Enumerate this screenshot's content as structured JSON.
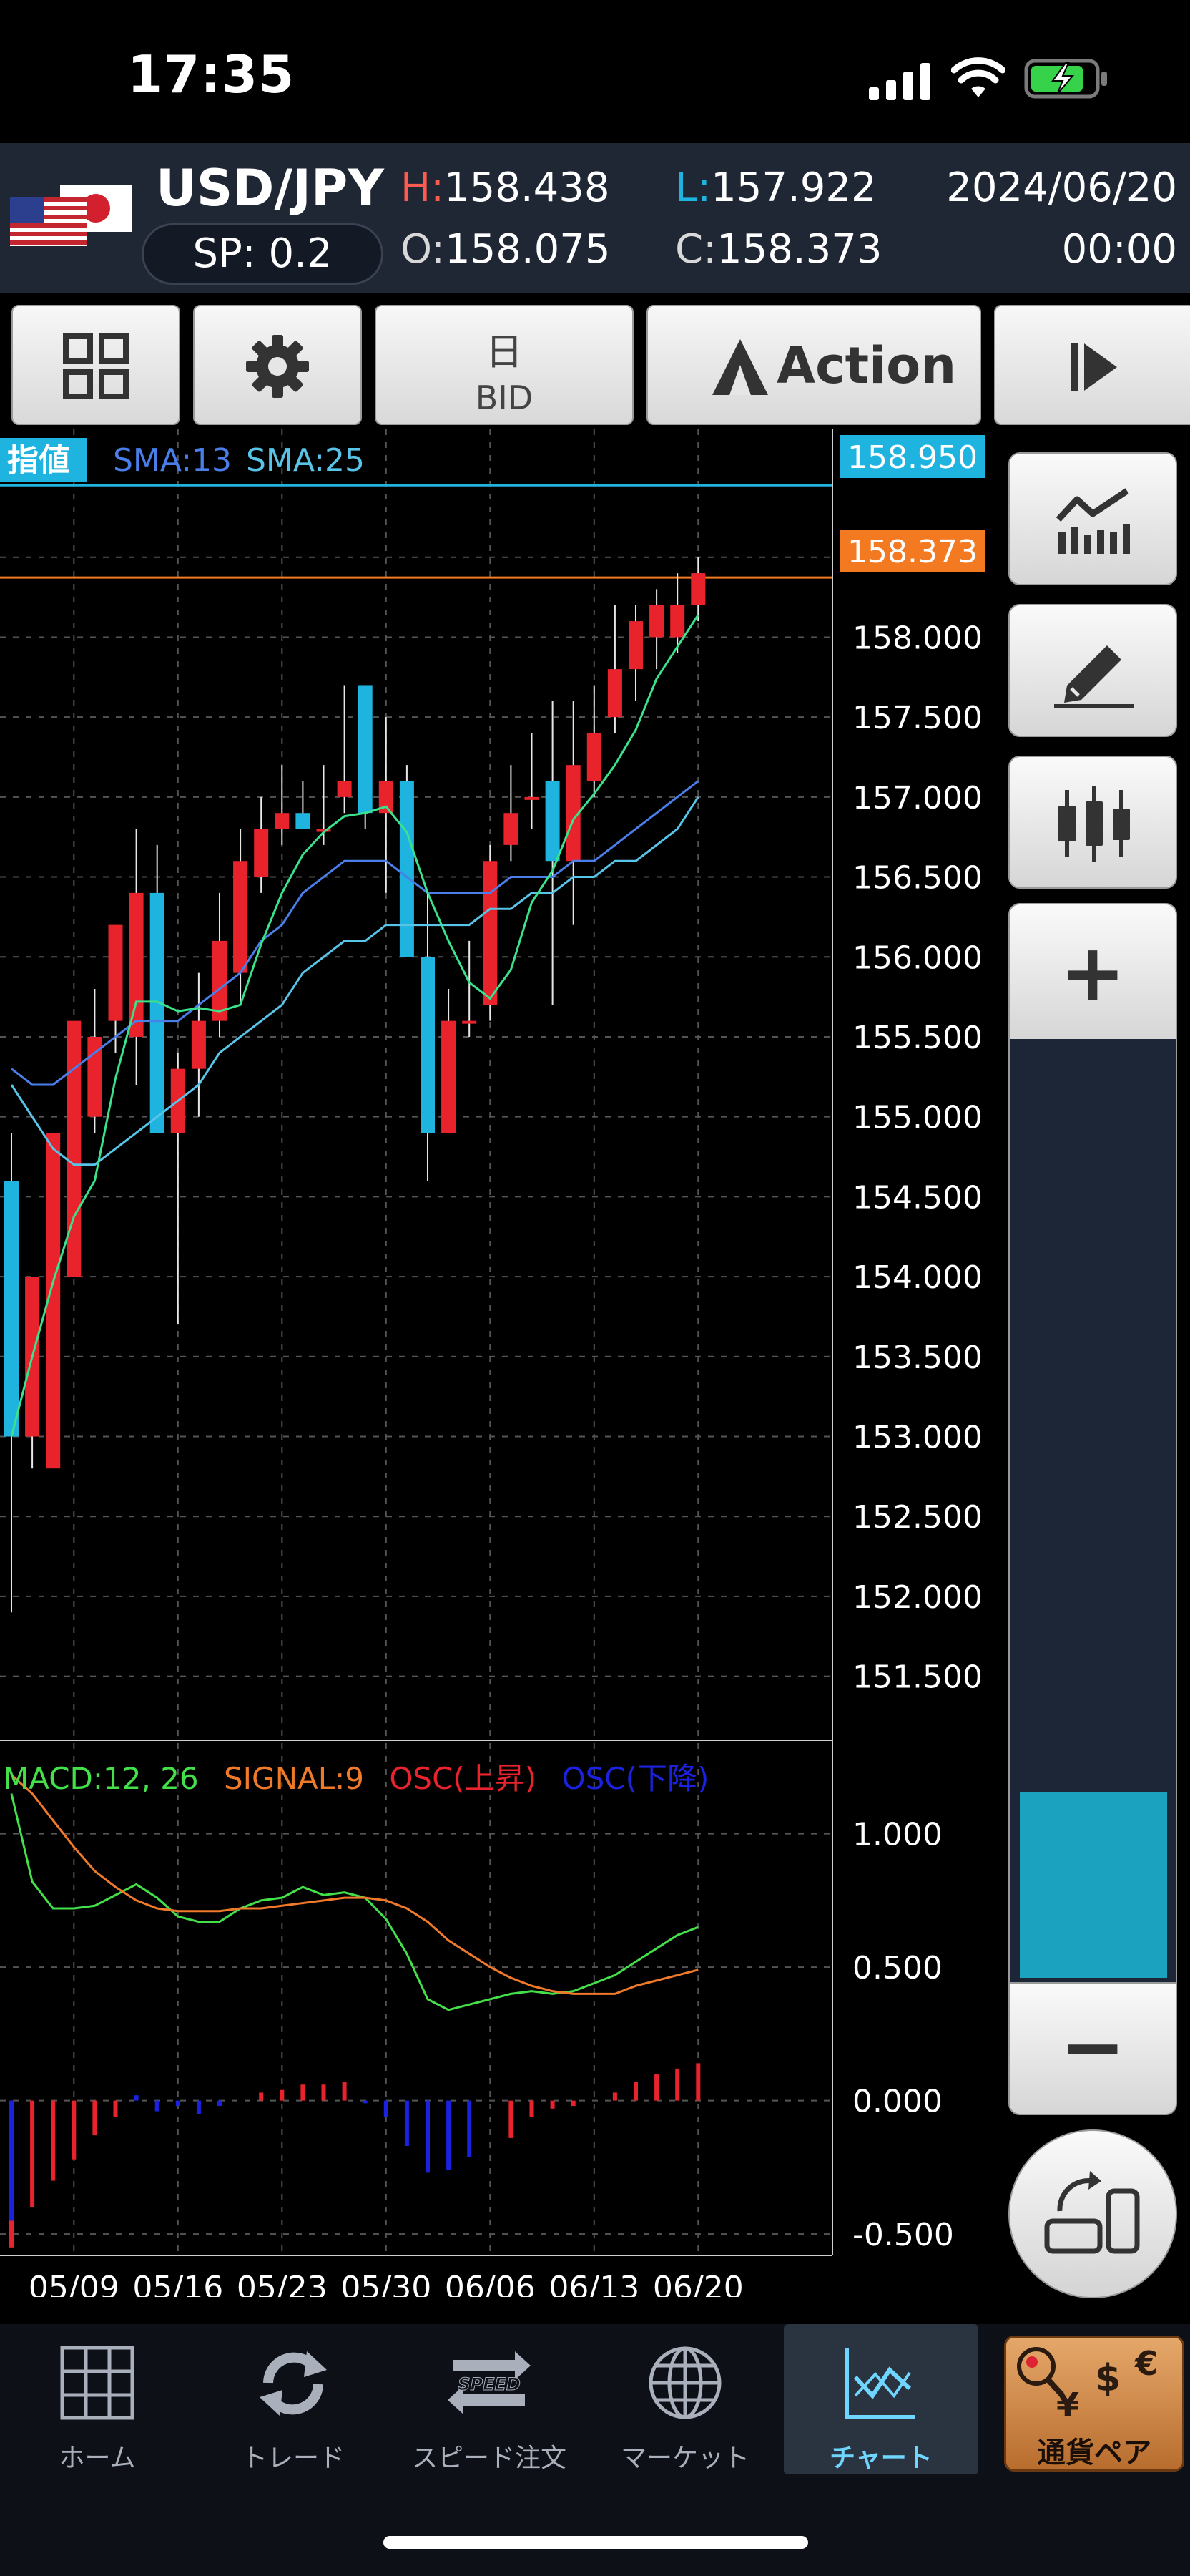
{
  "status_bar": {
    "time": "17:35"
  },
  "header": {
    "pair": "USD/JPY",
    "high_label": "H:",
    "high": "158.438",
    "low_label": "L:",
    "low": "157.922",
    "open_label": "O:",
    "open": "158.075",
    "close_label": "C:",
    "close": "158.373",
    "spread": "SP: 0.2",
    "date": "2024/06/20",
    "time": "00:00"
  },
  "toolbar": {
    "period": "日",
    "price_type": "BID",
    "action": "Action"
  },
  "main_chart": {
    "legend_badge": "指値",
    "legend_sma13": "SMA:13",
    "legend_sma25": "SMA:25",
    "limit_price": "158.950",
    "current_price": "158.373",
    "y_ticks": [
      "158.000",
      "157.500",
      "157.000",
      "156.500",
      "156.000",
      "155.500",
      "155.000",
      "154.500",
      "154.000",
      "153.500",
      "153.000",
      "152.500",
      "152.000",
      "151.500"
    ]
  },
  "macd": {
    "legend_macd": "MACD:12, 26",
    "legend_signal": "SIGNAL:9",
    "legend_osc_up": "OSC(上昇)",
    "legend_osc_down": "OSC(下降)",
    "y_ticks": [
      "1.000",
      "0.500",
      "0.000",
      "-0.500"
    ]
  },
  "x_ticks": [
    "05/09",
    "05/16",
    "05/23",
    "05/30",
    "06/06",
    "06/13",
    "06/20"
  ],
  "colors": {
    "up": "#e8232c",
    "down": "#1fb3e0",
    "sma5": "#3be28c",
    "sma13": "#4a7ee8",
    "sma25": "#58c4e8",
    "macd": "#44e04a",
    "signal": "#f07a2a",
    "osc_up": "#e8232c",
    "osc_down": "#1a22e0",
    "price_badge": "#f37a21",
    "limit_badge": "#1fb3e0"
  },
  "chart_data": [
    {
      "type": "candlestick",
      "title": "USD/JPY",
      "ylim": [
        151.1,
        159.3
      ],
      "x": [
        "05/06",
        "05/07",
        "05/08",
        "05/09",
        "05/10",
        "05/13",
        "05/14",
        "05/15",
        "05/16",
        "05/17",
        "05/20",
        "05/21",
        "05/22",
        "05/23",
        "05/24",
        "05/27",
        "05/28",
        "05/29",
        "05/30",
        "05/31",
        "06/03",
        "06/04",
        "06/05",
        "06/06",
        "06/07",
        "06/10",
        "06/11",
        "06/12",
        "06/13",
        "06/14",
        "06/17",
        "06/18",
        "06/19",
        "06/20"
      ],
      "open": [
        154.6,
        153.0,
        152.8,
        154.0,
        155.0,
        155.6,
        155.5,
        156.4,
        154.9,
        155.3,
        155.6,
        155.9,
        156.5,
        156.8,
        156.9,
        156.8,
        157.0,
        157.7,
        156.9,
        157.1,
        156.0,
        154.9,
        155.6,
        155.7,
        156.7,
        157.0,
        157.1,
        156.6,
        157.1,
        157.5,
        157.8,
        158.0,
        158.0,
        158.2
      ],
      "high": [
        154.9,
        153.3,
        154.1,
        155.2,
        155.8,
        155.8,
        156.8,
        156.7,
        155.4,
        155.9,
        156.4,
        156.8,
        157.0,
        157.2,
        157.1,
        157.2,
        157.7,
        157.7,
        157.5,
        157.2,
        156.4,
        155.8,
        156.1,
        156.7,
        157.2,
        157.4,
        157.6,
        157.6,
        157.7,
        158.2,
        158.2,
        158.3,
        158.4,
        158.5
      ],
      "high_": "",
      "low": [
        151.9,
        152.8,
        153.4,
        154.4,
        154.9,
        155.4,
        155.2,
        155.4,
        153.7,
        155.0,
        155.5,
        155.7,
        156.4,
        156.7,
        156.8,
        156.7,
        156.9,
        156.8,
        156.4,
        156.0,
        154.6,
        154.9,
        155.5,
        155.6,
        156.6,
        156.8,
        155.7,
        156.2,
        157.0,
        157.4,
        157.6,
        157.8,
        157.9,
        158.1
      ],
      "close": [
        153.0,
        154.0,
        154.9,
        155.6,
        155.5,
        156.2,
        156.4,
        154.9,
        155.3,
        155.6,
        156.1,
        156.6,
        156.8,
        156.9,
        156.8,
        156.8,
        157.1,
        156.9,
        157.1,
        156.0,
        154.9,
        155.6,
        155.6,
        156.6,
        156.9,
        157.0,
        156.6,
        157.2,
        157.4,
        157.8,
        158.1,
        158.2,
        158.2,
        158.4
      ],
      "series": [
        {
          "name": "SMA:13",
          "values": [
            155.3,
            155.2,
            155.2,
            155.3,
            155.4,
            155.5,
            155.6,
            155.6,
            155.6,
            155.7,
            155.8,
            155.9,
            156.1,
            156.2,
            156.4,
            156.5,
            156.6,
            156.6,
            156.6,
            156.5,
            156.4,
            156.4,
            156.4,
            156.4,
            156.5,
            156.5,
            156.5,
            156.6,
            156.6,
            156.7,
            156.8,
            156.9,
            157.0,
            157.1
          ]
        },
        {
          "name": "SMA:25",
          "values": [
            155.2,
            155.0,
            154.8,
            154.7,
            154.7,
            154.8,
            154.9,
            155.0,
            155.1,
            155.2,
            155.4,
            155.5,
            155.6,
            155.7,
            155.9,
            156.0,
            156.1,
            156.1,
            156.2,
            156.2,
            156.2,
            156.2,
            156.2,
            156.3,
            156.3,
            156.4,
            156.4,
            156.5,
            156.5,
            156.6,
            156.6,
            156.7,
            156.8,
            157.0
          ]
        }
      ]
    },
    {
      "type": "line",
      "title": "MACD:12, 26 SIGNAL:9",
      "ylim": [
        -0.58,
        1.35
      ],
      "x": [
        "05/06",
        "05/07",
        "05/08",
        "05/09",
        "05/10",
        "05/13",
        "05/14",
        "05/15",
        "05/16",
        "05/17",
        "05/20",
        "05/21",
        "05/22",
        "05/23",
        "05/24",
        "05/27",
        "05/28",
        "05/29",
        "05/30",
        "05/31",
        "06/03",
        "06/04",
        "06/05",
        "06/06",
        "06/07",
        "06/10",
        "06/11",
        "06/12",
        "06/13",
        "06/14",
        "06/17",
        "06/18",
        "06/19",
        "06/20"
      ],
      "series": [
        {
          "name": "MACD:12, 26",
          "values": [
            1.15,
            0.82,
            0.72,
            0.72,
            0.73,
            0.77,
            0.81,
            0.76,
            0.69,
            0.67,
            0.67,
            0.72,
            0.75,
            0.76,
            0.8,
            0.77,
            0.78,
            0.76,
            0.68,
            0.55,
            0.38,
            0.34,
            0.36,
            0.38,
            0.4,
            0.41,
            0.4,
            0.41,
            0.44,
            0.47,
            0.52,
            0.57,
            0.62,
            0.65
          ]
        },
        {
          "name": "SIGNAL:9",
          "values": [
            1.22,
            1.15,
            1.05,
            0.95,
            0.86,
            0.8,
            0.75,
            0.72,
            0.71,
            0.71,
            0.71,
            0.72,
            0.72,
            0.73,
            0.74,
            0.75,
            0.76,
            0.76,
            0.75,
            0.72,
            0.67,
            0.6,
            0.55,
            0.5,
            0.46,
            0.43,
            0.41,
            0.4,
            0.4,
            0.4,
            0.43,
            0.45,
            0.47,
            0.49
          ]
        },
        {
          "name": "OSC(上昇)",
          "values": [
            -0.55,
            -0.4,
            -0.3,
            -0.22,
            -0.13,
            -0.06,
            0,
            0,
            0,
            0,
            0,
            0,
            0.03,
            0.04,
            0.06,
            0.06,
            0.07,
            0,
            0,
            0,
            0,
            0,
            0,
            0,
            -0.14,
            -0.06,
            -0.03,
            -0.02,
            0,
            0.03,
            0.07,
            0.1,
            0.12,
            0.14
          ]
        },
        {
          "name": "OSC(下降)",
          "values": [
            -0.45,
            0,
            0,
            0,
            0,
            0,
            0.02,
            -0.04,
            -0.02,
            -0.05,
            -0.02,
            0,
            0,
            0,
            0,
            0,
            0,
            -0.01,
            -0.06,
            -0.17,
            -0.27,
            -0.26,
            -0.21,
            0,
            0,
            0,
            0,
            0,
            0,
            0,
            0,
            0,
            0,
            0
          ]
        }
      ]
    }
  ],
  "right_panel": {
    "zoom_in": "+",
    "zoom_out": "−"
  },
  "tabs": [
    {
      "label": "ホーム"
    },
    {
      "label": "トレード"
    },
    {
      "label": "スピード注文",
      "icon_text": "SPEED"
    },
    {
      "label": "マーケット"
    },
    {
      "label": "チャート"
    },
    {
      "label": "通貨ペア"
    }
  ]
}
